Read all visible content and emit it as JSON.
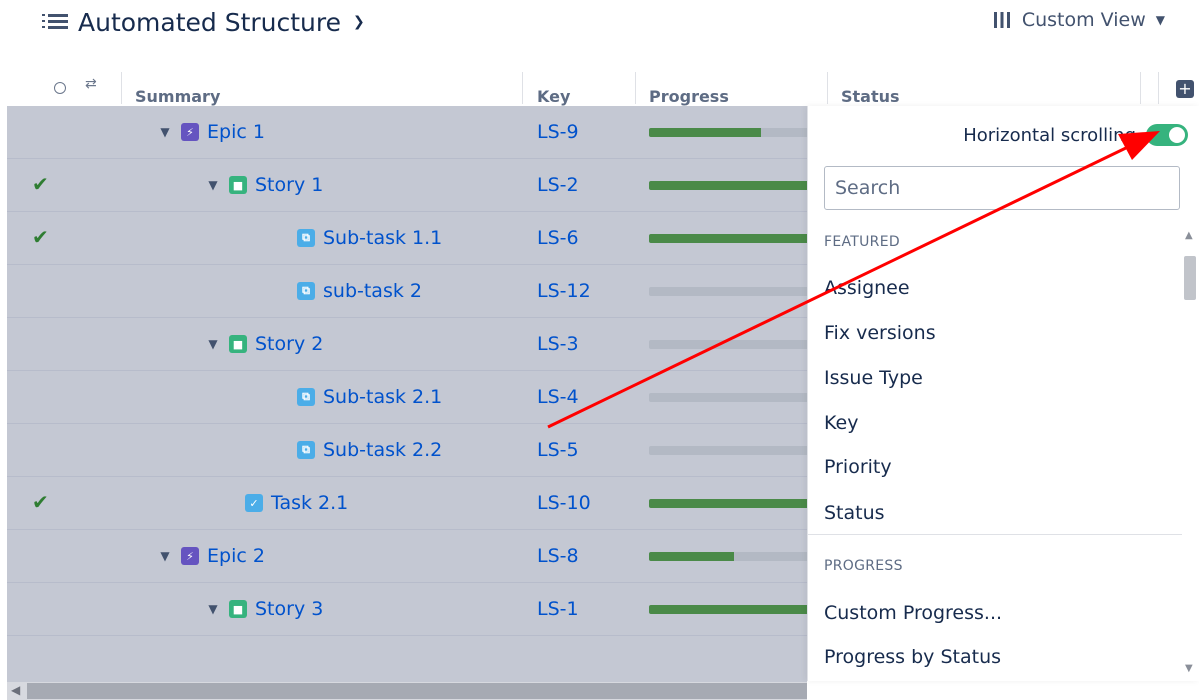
{
  "header": {
    "title": "Automated Structure",
    "view_label": "Custom View"
  },
  "columns": {
    "summary": "Summary",
    "key": "Key",
    "progress": "Progress",
    "status": "Status"
  },
  "rows": [
    {
      "summary": "Epic 1",
      "key": "LS-9",
      "type": "epic",
      "check": false,
      "progress": 0.7
    },
    {
      "summary": "Story 1",
      "key": "LS-2",
      "type": "story",
      "check": true,
      "progress": 1.0
    },
    {
      "summary": "Sub-task 1.1",
      "key": "LS-6",
      "type": "subtask",
      "check": true,
      "progress": 1.0
    },
    {
      "summary": "sub-task 2",
      "key": "LS-12",
      "type": "subtask",
      "check": false,
      "progress": 0
    },
    {
      "summary": "Story 2",
      "key": "LS-3",
      "type": "story",
      "check": false,
      "progress": 0
    },
    {
      "summary": "Sub-task 2.1",
      "key": "LS-4",
      "type": "subtask",
      "check": false,
      "progress": 0
    },
    {
      "summary": "Sub-task 2.2",
      "key": "LS-5",
      "type": "subtask",
      "check": false,
      "progress": 0
    },
    {
      "summary": "Task 2.1",
      "key": "LS-10",
      "type": "task",
      "check": true,
      "progress": 1.0
    },
    {
      "summary": "Epic 2",
      "key": "LS-8",
      "type": "epic",
      "check": false,
      "progress": 0.53
    },
    {
      "summary": "Story 3",
      "key": "LS-1",
      "type": "story",
      "check": false,
      "progress": 1.0
    }
  ],
  "panel": {
    "toggle_label": "Horizontal scrolling",
    "toggle_on": true,
    "search_placeholder": "Search",
    "featured_header": "FEATURED",
    "featured": [
      "Assignee",
      "Fix versions",
      "Issue Type",
      "Key",
      "Priority",
      "Status"
    ],
    "progress_header": "PROGRESS",
    "progress_items": [
      "Custom Progress...",
      "Progress by Status"
    ]
  },
  "colors": {
    "accent": "#0052cc",
    "epic": "#6554c0",
    "story": "#36b37e",
    "subtask": "#4bade8",
    "task": "#4bade8",
    "progress_fill": "#4a8a48",
    "toggle_on": "#36b37e",
    "annotation_arrow": "#ff0000"
  },
  "icons": {
    "title": "structure-list-icon",
    "view": "columns-icon",
    "chevron": "chevron-down-icon",
    "add_column": "plus-square-icon",
    "check": "checkmark-icon"
  }
}
